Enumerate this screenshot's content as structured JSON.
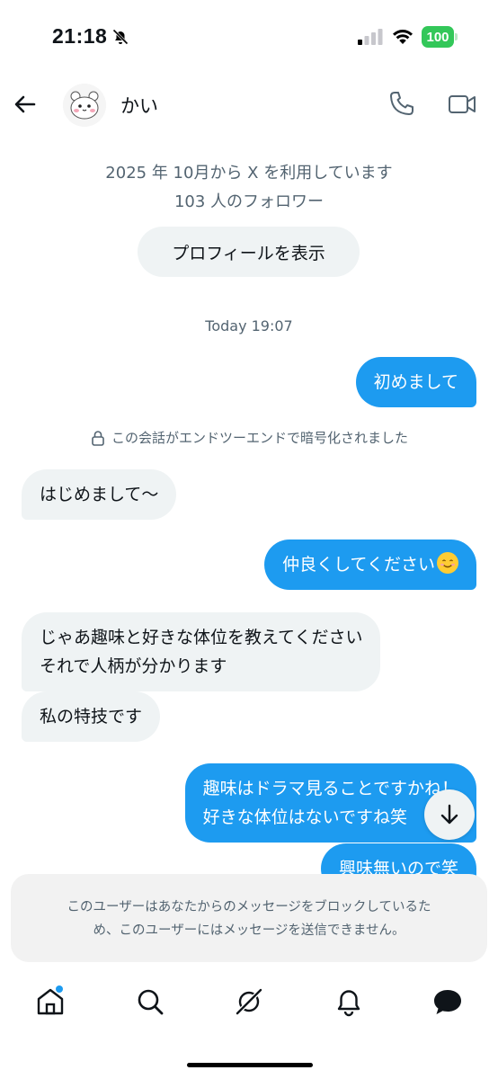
{
  "status_bar": {
    "time": "21:18",
    "battery": "100",
    "battery_color": "#33c759"
  },
  "header": {
    "contact_name": "かい"
  },
  "profile_info": {
    "joined": "2025 年 10月から X を利用しています",
    "followers": "103 人のフォロワー",
    "view_profile_label": "プロフィールを表示"
  },
  "conversation": {
    "timestamp": "Today 19:07",
    "encryption_notice": "この会話がエンドツーエンドで暗号化されました",
    "messages": [
      {
        "direction": "outgoing",
        "text": "初めまして"
      },
      {
        "direction": "incoming",
        "text": "はじめまして〜"
      },
      {
        "direction": "outgoing",
        "text": "仲良くしてください",
        "emoji": "smiling-face"
      },
      {
        "direction": "incoming",
        "text_line1": "じゃあ趣味と好きな体位を教えてください",
        "text_line2": "それで人柄が分かります"
      },
      {
        "direction": "incoming",
        "text": "私の特技です"
      },
      {
        "direction": "outgoing",
        "text_line1": "趣味はドラマ見ることですかね！",
        "text_line2": "好きな体位はないですね笑"
      },
      {
        "direction": "outgoing",
        "text": "興味無いので笑"
      }
    ]
  },
  "blocked_notice": {
    "line1": "このユーザーはあなたからのメッセージをブロックしているた",
    "line2": "め、このユーザーにはメッセージを送信できません。"
  },
  "tabbar": {
    "items": [
      "home-icon",
      "search-icon",
      "grok-icon",
      "bell-icon",
      "messages-icon"
    ],
    "active": "messages-icon",
    "notification_dot_color": "#1d9bf0"
  },
  "colors": {
    "accent": "#1d9bf0",
    "incoming_bubble": "#eff3f4",
    "secondary_text": "#536471"
  }
}
